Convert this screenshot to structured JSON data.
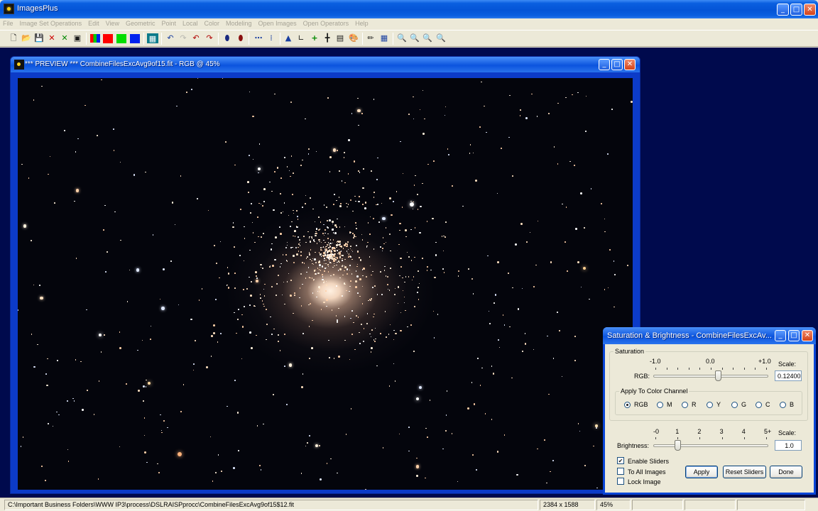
{
  "app": {
    "title": "ImagesPlus",
    "window_buttons": {
      "minimize": "_",
      "maximize": "□",
      "close": "✕"
    }
  },
  "menu": [
    "File",
    "Image Set Operations",
    "Edit",
    "View",
    "Geometric",
    "Point",
    "Local",
    "Color",
    "Modeling",
    "Open Images",
    "Open Operators",
    "Help"
  ],
  "toolbar": {
    "icons": [
      "new-file-icon",
      "open-folder-icon",
      "save-icon",
      "close-red-icon",
      "close-green-icon",
      "print-icon",
      "color-bars-icon",
      "red-channel-icon",
      "green-channel-icon",
      "blue-channel-icon",
      "grid-icon",
      "undo-icon",
      "redo-icon",
      "undo-all-icon",
      "redo-all-icon",
      "mask-black-icon",
      "mask-red-icon",
      "dots-icon",
      "dots-chart-icon",
      "triangle-icon",
      "curve-icon",
      "crosshair-green-icon",
      "crosshair-icon",
      "calculator-icon",
      "palette-icon",
      "pencil-icon",
      "pattern-icon",
      "zoom-in-icon",
      "zoom-out-icon",
      "zoom-fit-icon",
      "zoom-actual-icon"
    ],
    "colors": {
      "red": "#ff0000",
      "green": "#00dd00",
      "blue": "#0022ee"
    }
  },
  "preview": {
    "title": "*** PREVIEW *** CombineFilesExcAvg9of15.fit - RGB @ 45%",
    "stars_seed": 20240
  },
  "dialog": {
    "title": "Saturation & Brightness - CombineFilesExcAv...",
    "saturation": {
      "group_label": "Saturation",
      "scale_marks": [
        "-1.0",
        "0.0",
        "+1.0"
      ],
      "row_label": "RGB:",
      "scale_label": "Scale:",
      "scale_value": "0.12400",
      "slider_fraction": 0.56
    },
    "channel": {
      "group_label": "Apply To Color Channel",
      "options": [
        "RGB",
        "M",
        "R",
        "Y",
        "G",
        "C",
        "B"
      ],
      "selected": "RGB"
    },
    "brightness": {
      "scale_marks": [
        "-0",
        "1",
        "2",
        "3",
        "4",
        "5+"
      ],
      "row_label": "Brightness:",
      "scale_label": "Scale:",
      "scale_value": "1.0",
      "slider_fraction": 0.21
    },
    "checkboxes": [
      {
        "label": "Enable Sliders",
        "checked": true
      },
      {
        "label": "To All Images",
        "checked": false
      },
      {
        "label": "Lock Image",
        "checked": false
      }
    ],
    "buttons": {
      "apply": "Apply",
      "reset": "Reset Sliders",
      "done": "Done"
    }
  },
  "status": {
    "path": "C:\\Important Business Folders\\WWW IP3\\process\\DSLRAISPprocc\\CombineFilesExcAvg9of15$12.fit",
    "dimensions": "2384 x 1588",
    "zoom": "45%"
  }
}
